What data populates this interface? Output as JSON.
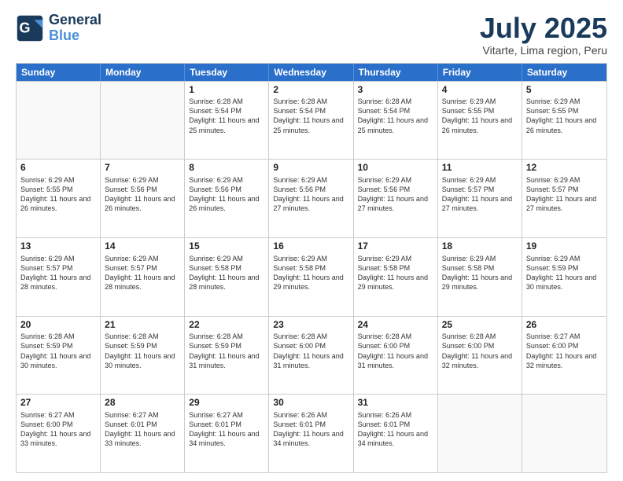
{
  "logo": {
    "line1": "General",
    "line2": "Blue"
  },
  "title": "July 2025",
  "subtitle": "Vitarte, Lima region, Peru",
  "header_days": [
    "Sunday",
    "Monday",
    "Tuesday",
    "Wednesday",
    "Thursday",
    "Friday",
    "Saturday"
  ],
  "weeks": [
    [
      {
        "day": "",
        "info": ""
      },
      {
        "day": "",
        "info": ""
      },
      {
        "day": "1",
        "info": "Sunrise: 6:28 AM\nSunset: 5:54 PM\nDaylight: 11 hours and 25 minutes."
      },
      {
        "day": "2",
        "info": "Sunrise: 6:28 AM\nSunset: 5:54 PM\nDaylight: 11 hours and 25 minutes."
      },
      {
        "day": "3",
        "info": "Sunrise: 6:28 AM\nSunset: 5:54 PM\nDaylight: 11 hours and 25 minutes."
      },
      {
        "day": "4",
        "info": "Sunrise: 6:29 AM\nSunset: 5:55 PM\nDaylight: 11 hours and 26 minutes."
      },
      {
        "day": "5",
        "info": "Sunrise: 6:29 AM\nSunset: 5:55 PM\nDaylight: 11 hours and 26 minutes."
      }
    ],
    [
      {
        "day": "6",
        "info": "Sunrise: 6:29 AM\nSunset: 5:55 PM\nDaylight: 11 hours and 26 minutes."
      },
      {
        "day": "7",
        "info": "Sunrise: 6:29 AM\nSunset: 5:56 PM\nDaylight: 11 hours and 26 minutes."
      },
      {
        "day": "8",
        "info": "Sunrise: 6:29 AM\nSunset: 5:56 PM\nDaylight: 11 hours and 26 minutes."
      },
      {
        "day": "9",
        "info": "Sunrise: 6:29 AM\nSunset: 5:56 PM\nDaylight: 11 hours and 27 minutes."
      },
      {
        "day": "10",
        "info": "Sunrise: 6:29 AM\nSunset: 5:56 PM\nDaylight: 11 hours and 27 minutes."
      },
      {
        "day": "11",
        "info": "Sunrise: 6:29 AM\nSunset: 5:57 PM\nDaylight: 11 hours and 27 minutes."
      },
      {
        "day": "12",
        "info": "Sunrise: 6:29 AM\nSunset: 5:57 PM\nDaylight: 11 hours and 27 minutes."
      }
    ],
    [
      {
        "day": "13",
        "info": "Sunrise: 6:29 AM\nSunset: 5:57 PM\nDaylight: 11 hours and 28 minutes."
      },
      {
        "day": "14",
        "info": "Sunrise: 6:29 AM\nSunset: 5:57 PM\nDaylight: 11 hours and 28 minutes."
      },
      {
        "day": "15",
        "info": "Sunrise: 6:29 AM\nSunset: 5:58 PM\nDaylight: 11 hours and 28 minutes."
      },
      {
        "day": "16",
        "info": "Sunrise: 6:29 AM\nSunset: 5:58 PM\nDaylight: 11 hours and 29 minutes."
      },
      {
        "day": "17",
        "info": "Sunrise: 6:29 AM\nSunset: 5:58 PM\nDaylight: 11 hours and 29 minutes."
      },
      {
        "day": "18",
        "info": "Sunrise: 6:29 AM\nSunset: 5:58 PM\nDaylight: 11 hours and 29 minutes."
      },
      {
        "day": "19",
        "info": "Sunrise: 6:29 AM\nSunset: 5:59 PM\nDaylight: 11 hours and 30 minutes."
      }
    ],
    [
      {
        "day": "20",
        "info": "Sunrise: 6:28 AM\nSunset: 5:59 PM\nDaylight: 11 hours and 30 minutes."
      },
      {
        "day": "21",
        "info": "Sunrise: 6:28 AM\nSunset: 5:59 PM\nDaylight: 11 hours and 30 minutes."
      },
      {
        "day": "22",
        "info": "Sunrise: 6:28 AM\nSunset: 5:59 PM\nDaylight: 11 hours and 31 minutes."
      },
      {
        "day": "23",
        "info": "Sunrise: 6:28 AM\nSunset: 6:00 PM\nDaylight: 11 hours and 31 minutes."
      },
      {
        "day": "24",
        "info": "Sunrise: 6:28 AM\nSunset: 6:00 PM\nDaylight: 11 hours and 31 minutes."
      },
      {
        "day": "25",
        "info": "Sunrise: 6:28 AM\nSunset: 6:00 PM\nDaylight: 11 hours and 32 minutes."
      },
      {
        "day": "26",
        "info": "Sunrise: 6:27 AM\nSunset: 6:00 PM\nDaylight: 11 hours and 32 minutes."
      }
    ],
    [
      {
        "day": "27",
        "info": "Sunrise: 6:27 AM\nSunset: 6:00 PM\nDaylight: 11 hours and 33 minutes."
      },
      {
        "day": "28",
        "info": "Sunrise: 6:27 AM\nSunset: 6:01 PM\nDaylight: 11 hours and 33 minutes."
      },
      {
        "day": "29",
        "info": "Sunrise: 6:27 AM\nSunset: 6:01 PM\nDaylight: 11 hours and 34 minutes."
      },
      {
        "day": "30",
        "info": "Sunrise: 6:26 AM\nSunset: 6:01 PM\nDaylight: 11 hours and 34 minutes."
      },
      {
        "day": "31",
        "info": "Sunrise: 6:26 AM\nSunset: 6:01 PM\nDaylight: 11 hours and 34 minutes."
      },
      {
        "day": "",
        "info": ""
      },
      {
        "day": "",
        "info": ""
      }
    ]
  ]
}
